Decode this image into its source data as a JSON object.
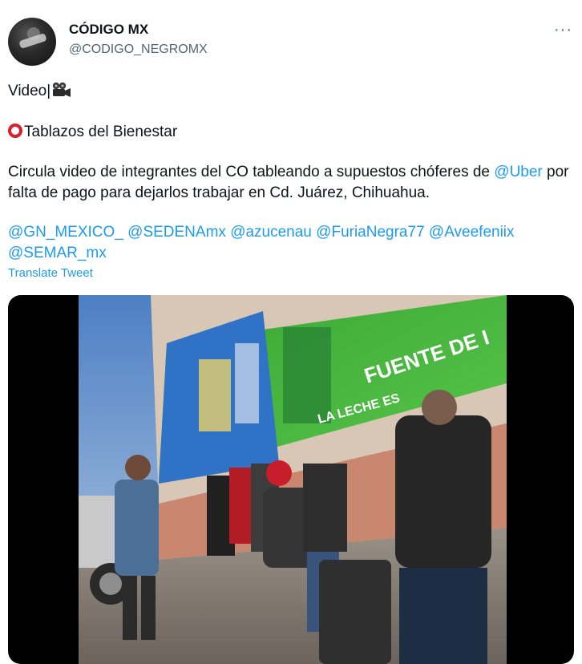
{
  "tweet": {
    "author_name": "CÓDIGO MX",
    "author_handle": "@CODIGO_NEGROMX",
    "more_icon": "more-horizontal-icon",
    "video_label": "Video|",
    "camera_icon": "movie-camera-icon",
    "circle_icon": "red-circle-icon",
    "headline": "Tablazos del Bienestar",
    "body_before_mention": "Circula video de integrantes del CO tableando a supuestos chóferes de",
    "body_mention": "@Uber",
    "body_after_mention": " por falta de pago para dejarlos trabajar en Cd. Juárez, Chihuahua.",
    "mentions": [
      "@GN_MEXICO_",
      "@SEDENAmx",
      "@azucenau",
      "@FuriaNegra77",
      "@Aveefeniix",
      "@SEMAR_mx"
    ],
    "translate_label": "Translate Tweet",
    "link_color": "#1d9bf0",
    "text_color": "#0f1419",
    "muted_color": "#536471"
  },
  "media": {
    "type": "video",
    "billboard_text_1": "LA LECHE ES FUENTE DE",
    "billboard_text_2": "FUENTE DE I"
  }
}
